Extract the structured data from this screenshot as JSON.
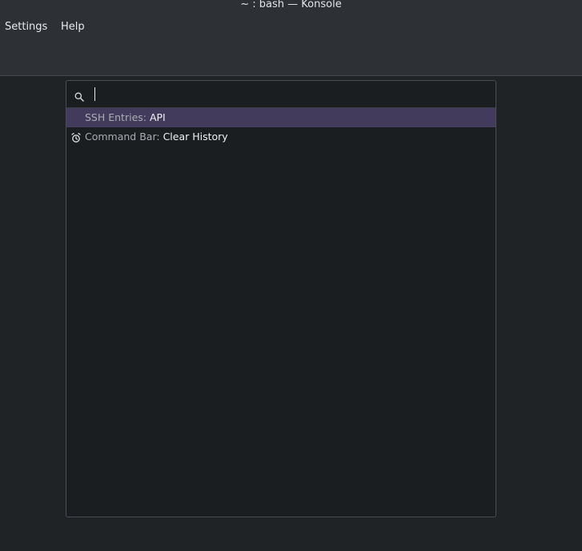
{
  "window": {
    "title": "~ : bash — Konsole"
  },
  "menubar": {
    "items": [
      {
        "label": "Settings"
      },
      {
        "label": "Help"
      }
    ]
  },
  "command_bar": {
    "search": {
      "value": "",
      "placeholder": "",
      "icon": "search-icon"
    },
    "results": [
      {
        "category": "SSH Entries",
        "separator": ": ",
        "action": "API",
        "icon": "",
        "selected": true
      },
      {
        "category": "Command Bar",
        "separator": ": ",
        "action": "Clear History",
        "icon": "clear-history-icon",
        "selected": false
      }
    ]
  },
  "colors": {
    "background": "#202326",
    "menubar": "#2d3136",
    "palette": "#1b1e20",
    "selection": "#433b5c"
  }
}
